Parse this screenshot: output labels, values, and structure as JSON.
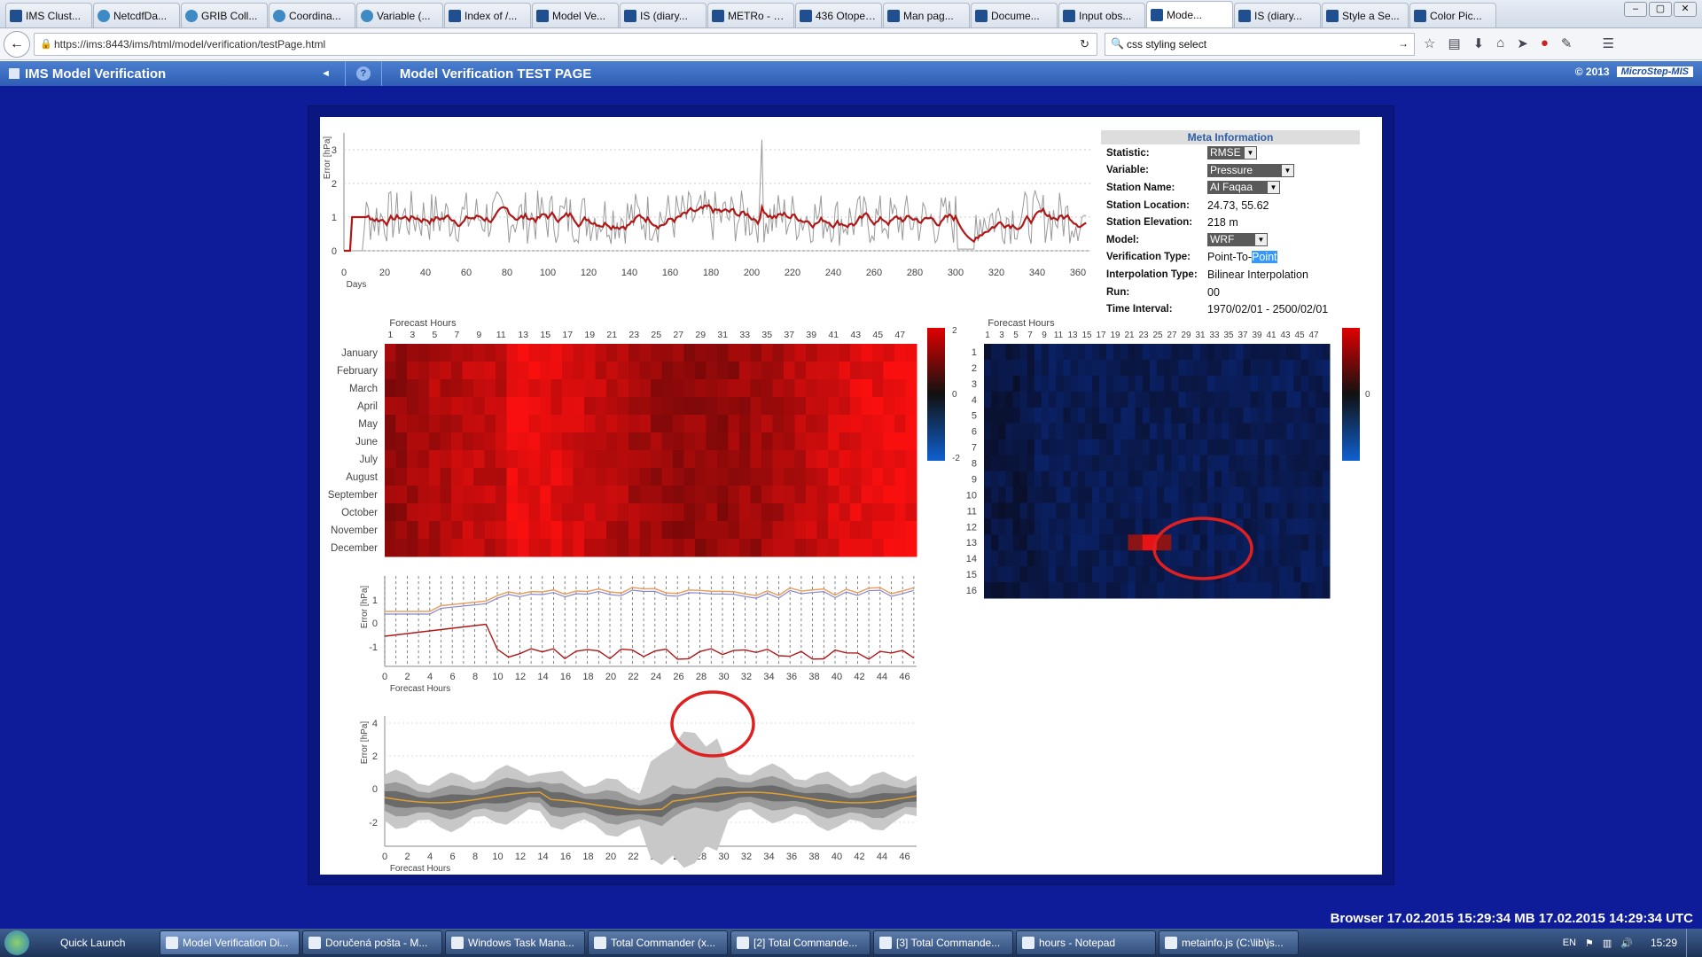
{
  "browser": {
    "tabs": [
      {
        "label": "IMS Clust...",
        "icon": "doc-icon",
        "active": false
      },
      {
        "label": "NetcdfDa...",
        "icon": "globe-icon",
        "active": false
      },
      {
        "label": "GRIB Coll...",
        "icon": "globe-icon",
        "active": false
      },
      {
        "label": "Coordina...",
        "icon": "globe-icon",
        "active": false
      },
      {
        "label": "Variable (...",
        "icon": "globe-icon",
        "active": false
      },
      {
        "label": "Index of /...",
        "icon": "gear-icon",
        "active": false
      },
      {
        "label": "Model Ve...",
        "icon": "doc-icon",
        "active": false
      },
      {
        "label": "IS (diary...",
        "icon": "doc-icon",
        "active": false
      },
      {
        "label": "METRo - Wiki...",
        "icon": "doc-icon",
        "active": false
      },
      {
        "label": "436 Otopeni ...",
        "icon": "doc-icon",
        "active": false
      },
      {
        "label": "Man pag...",
        "icon": "doc-icon",
        "active": false
      },
      {
        "label": "Docume...",
        "icon": "doc-icon",
        "active": false
      },
      {
        "label": "Input obs...",
        "icon": "doc-icon",
        "active": false
      },
      {
        "label": "Mode...",
        "icon": "doc-icon",
        "active": true
      },
      {
        "label": "IS (diary...",
        "icon": "doc-icon",
        "active": false
      },
      {
        "label": "Style a Se...",
        "icon": "doc-icon",
        "active": false
      },
      {
        "label": "Color Pic...",
        "icon": "doc-icon",
        "active": false
      }
    ],
    "url": "https://ims:8443/ims/html/model/verification/testPage.html",
    "search": "css styling select"
  },
  "app": {
    "title": "IMS  Model Verification",
    "page_title": "Model Verification TEST PAGE",
    "copyright": "© 2013",
    "brand": "MicroStep-MIS"
  },
  "meta": {
    "title": "Meta Information",
    "rows": [
      {
        "key": "Statistic:",
        "value": "RMSE",
        "type": "select"
      },
      {
        "key": "Variable:",
        "value": "Pressure",
        "type": "select"
      },
      {
        "key": "Station Name:",
        "value": "Al Faqaa",
        "type": "select"
      },
      {
        "key": "Station Location:",
        "value": "24.73, 55.62",
        "type": "text"
      },
      {
        "key": "Station Elevation:",
        "value": "218 m",
        "type": "text"
      },
      {
        "key": "Model:",
        "value": "WRF",
        "type": "select"
      },
      {
        "key": "Verification Type:",
        "value": "Point-To-Point",
        "type": "text"
      },
      {
        "key": "Interpolation Type:",
        "value": "Bilinear Interpolation",
        "type": "text"
      },
      {
        "key": "Run:",
        "value": "00",
        "type": "text"
      },
      {
        "key": "Time Interval:",
        "value": "1970/02/01 - 2500/02/01",
        "type": "text"
      }
    ],
    "verification_plain": "Point-To-",
    "verification_selected": "Point"
  },
  "charts": {
    "timeseries": {
      "ylabel": "Error [hPa]",
      "xlabel": "Days",
      "xticks": [
        "0",
        "20",
        "40",
        "60",
        "80",
        "100",
        "120",
        "140",
        "160",
        "180",
        "200",
        "220",
        "240",
        "260",
        "280",
        "300",
        "320",
        "340",
        "360"
      ],
      "yticks": [
        "0",
        "1",
        "2",
        "3"
      ]
    },
    "heatmap_month": {
      "title": "Forecast Hours",
      "xticks": [
        "1",
        "3",
        "5",
        "7",
        "9",
        "11",
        "13",
        "15",
        "17",
        "19",
        "21",
        "23",
        "25",
        "27",
        "29",
        "31",
        "33",
        "35",
        "37",
        "39",
        "41",
        "43",
        "45",
        "47"
      ],
      "rows": [
        "January",
        "February",
        "March",
        "April",
        "May",
        "June",
        "July",
        "August",
        "September",
        "October",
        "November",
        "December"
      ],
      "scale": [
        "2",
        "0",
        "-2"
      ]
    },
    "heatmap_day": {
      "title": "Forecast Hours",
      "xticks": [
        "1",
        "3",
        "5",
        "7",
        "9",
        "11",
        "13",
        "15",
        "17",
        "19",
        "21",
        "23",
        "25",
        "27",
        "29",
        "31",
        "33",
        "35",
        "37",
        "39",
        "41",
        "43",
        "45",
        "47"
      ],
      "rows": [
        "1",
        "2",
        "3",
        "4",
        "5",
        "6",
        "7",
        "8",
        "9",
        "10",
        "11",
        "12",
        "13",
        "14",
        "15",
        "16"
      ],
      "scale": [
        "0"
      ]
    },
    "error_lines": {
      "ylabel": "Error [hPa]",
      "xlabel": "Forecast Hours",
      "yticks": [
        "1",
        "0",
        "-1"
      ],
      "xticks": [
        "0",
        "2",
        "4",
        "6",
        "8",
        "10",
        "12",
        "14",
        "16",
        "18",
        "20",
        "22",
        "24",
        "26",
        "28",
        "30",
        "32",
        "34",
        "36",
        "38",
        "40",
        "42",
        "44",
        "46"
      ]
    },
    "error_bands": {
      "ylabel": "Error [hPa]",
      "xlabel": "Forecast Hours",
      "yticks": [
        "4",
        "2",
        "0",
        "-2"
      ],
      "xticks": [
        "0",
        "2",
        "4",
        "6",
        "8",
        "10",
        "12",
        "14",
        "16",
        "18",
        "20",
        "22",
        "24",
        "26",
        "28",
        "30",
        "32",
        "34",
        "36",
        "38",
        "40",
        "42",
        "44",
        "46"
      ]
    }
  },
  "status_bar": "Browser  17.02.2015 15:29:34 MB   17.02.2015 14:29:34 UTC",
  "taskbar": {
    "quick_launch": "Quick Launch",
    "items": [
      {
        "label": "Model Verification Di...",
        "active": true
      },
      {
        "label": "Doručená pošta - M...",
        "active": false
      },
      {
        "label": "Windows Task Mana...",
        "active": false
      },
      {
        "label": "Total Commander (x...",
        "active": false
      },
      {
        "label": "[2] Total Commande...",
        "active": false
      },
      {
        "label": "[3] Total Commande...",
        "active": false
      },
      {
        "label": "hours - Notepad",
        "active": false
      },
      {
        "label": "metainfo.js (C:\\lib\\js...",
        "active": false
      }
    ],
    "lang": "EN",
    "clock": "15:29"
  },
  "colors": {
    "page_bg": "#0e1c9a",
    "header": "#2d5eb4",
    "highlight_circle": "#e02020",
    "series_red": "#b01818"
  }
}
